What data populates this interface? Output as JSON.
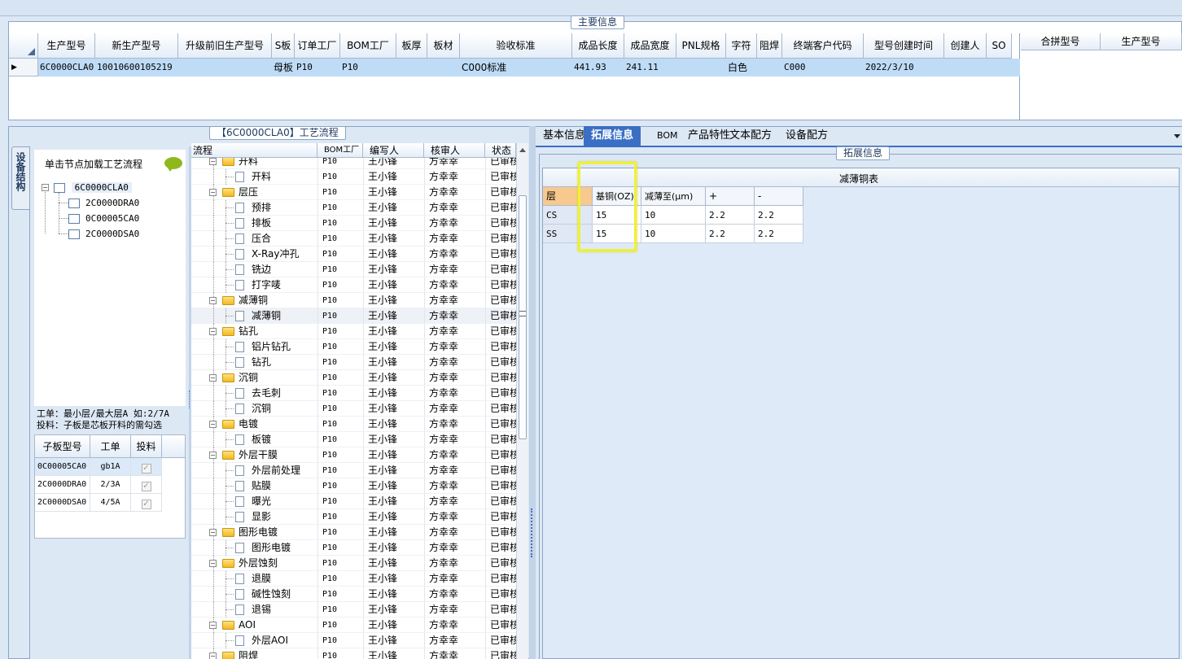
{
  "main_info": {
    "title": "主要信息",
    "columns": [
      "生产型号",
      "新生产型号",
      "升级前旧生产型号",
      "S板",
      "订单工厂",
      "BOM工厂",
      "板厚",
      "板材",
      "验收标准",
      "成品长度",
      "成品宽度",
      "PNL规格",
      "字符",
      "阻焊",
      "终端客户代码",
      "型号创建时间",
      "创建人",
      "SO"
    ],
    "row": [
      "6C0000CLA0",
      "10010600105219",
      "",
      "母板",
      "P10",
      "P10",
      "",
      "",
      "C000标准",
      "441.93",
      "241.11",
      "",
      "白色",
      "",
      "C000",
      "2022/3/10",
      "",
      ""
    ],
    "row_marker": "▶"
  },
  "merge_panel": {
    "columns": [
      "合拼型号",
      "生产型号"
    ]
  },
  "process_panel": {
    "title": "【6C0000CLA0】工艺流程"
  },
  "side_tab": {
    "label": "设备结构"
  },
  "structure": {
    "hint": "单击节点加载工艺流程",
    "tree": {
      "root": "6C0000CLA0",
      "children": [
        "2C0000DRA0",
        "0C00005CA0",
        "2C0000DSA0"
      ]
    },
    "note_line1": "工单：最小层/最大层A 如:2/7A",
    "note_line2": "投料：子板是芯板开料的需勾选",
    "sub_columns": [
      "子板型号",
      "工单",
      "投料"
    ],
    "sub_rows": [
      {
        "model": "0C00005CA0",
        "order": "gb1A",
        "check": "✓"
      },
      {
        "model": "2C0000DRA0",
        "order": "2/3A",
        "check": "✓"
      },
      {
        "model": "2C0000DSA0",
        "order": "4/5A",
        "check": "✓"
      }
    ]
  },
  "flow": {
    "columns": [
      "流程",
      "BOM工厂",
      "编写人",
      "核审人",
      "状态"
    ],
    "rows": [
      {
        "name": "开料",
        "level": 1,
        "factory": "P10",
        "writer": "王小锋",
        "reviewer": "方幸幸",
        "status": "已审核"
      },
      {
        "name": "开料",
        "level": 2,
        "factory": "P10",
        "writer": "王小锋",
        "reviewer": "方幸幸",
        "status": "已审核"
      },
      {
        "name": "层压",
        "level": 1,
        "factory": "P10",
        "writer": "王小锋",
        "reviewer": "方幸幸",
        "status": "已审核"
      },
      {
        "name": "预排",
        "level": 2,
        "factory": "P10",
        "writer": "王小锋",
        "reviewer": "方幸幸",
        "status": "已审核"
      },
      {
        "name": "排板",
        "level": 2,
        "factory": "P10",
        "writer": "王小锋",
        "reviewer": "方幸幸",
        "status": "已审核"
      },
      {
        "name": "压合",
        "level": 2,
        "factory": "P10",
        "writer": "王小锋",
        "reviewer": "方幸幸",
        "status": "已审核"
      },
      {
        "name": "X-Ray冲孔",
        "level": 2,
        "factory": "P10",
        "writer": "王小锋",
        "reviewer": "方幸幸",
        "status": "已审核"
      },
      {
        "name": "铣边",
        "level": 2,
        "factory": "P10",
        "writer": "王小锋",
        "reviewer": "方幸幸",
        "status": "已审核"
      },
      {
        "name": "打字唛",
        "level": 2,
        "factory": "P10",
        "writer": "王小锋",
        "reviewer": "方幸幸",
        "status": "已审核"
      },
      {
        "name": "减薄铜",
        "level": 1,
        "factory": "P10",
        "writer": "王小锋",
        "reviewer": "方幸幸",
        "status": "已审核"
      },
      {
        "name": "减薄铜",
        "level": 2,
        "factory": "P10",
        "writer": "王小锋",
        "reviewer": "方幸幸",
        "status": "已审核"
      },
      {
        "name": "钻孔",
        "level": 1,
        "factory": "P10",
        "writer": "王小锋",
        "reviewer": "方幸幸",
        "status": "已审核"
      },
      {
        "name": "铝片钻孔",
        "level": 2,
        "factory": "P10",
        "writer": "王小锋",
        "reviewer": "方幸幸",
        "status": "已审核"
      },
      {
        "name": "钻孔",
        "level": 2,
        "factory": "P10",
        "writer": "王小锋",
        "reviewer": "方幸幸",
        "status": "已审核"
      },
      {
        "name": "沉铜",
        "level": 1,
        "factory": "P10",
        "writer": "王小锋",
        "reviewer": "方幸幸",
        "status": "已审核"
      },
      {
        "name": "去毛刺",
        "level": 2,
        "factory": "P10",
        "writer": "王小锋",
        "reviewer": "方幸幸",
        "status": "已审核"
      },
      {
        "name": "沉铜",
        "level": 2,
        "factory": "P10",
        "writer": "王小锋",
        "reviewer": "方幸幸",
        "status": "已审核"
      },
      {
        "name": "电镀",
        "level": 1,
        "factory": "P10",
        "writer": "王小锋",
        "reviewer": "方幸幸",
        "status": "已审核"
      },
      {
        "name": "板镀",
        "level": 2,
        "factory": "P10",
        "writer": "王小锋",
        "reviewer": "方幸幸",
        "status": "已审核"
      },
      {
        "name": "外层干膜",
        "level": 1,
        "factory": "P10",
        "writer": "王小锋",
        "reviewer": "方幸幸",
        "status": "已审核"
      },
      {
        "name": "外层前处理",
        "level": 2,
        "factory": "P10",
        "writer": "王小锋",
        "reviewer": "方幸幸",
        "status": "已审核"
      },
      {
        "name": "贴膜",
        "level": 2,
        "factory": "P10",
        "writer": "王小锋",
        "reviewer": "方幸幸",
        "status": "已审核"
      },
      {
        "name": "曝光",
        "level": 2,
        "factory": "P10",
        "writer": "王小锋",
        "reviewer": "方幸幸",
        "status": "已审核"
      },
      {
        "name": "显影",
        "level": 2,
        "factory": "P10",
        "writer": "王小锋",
        "reviewer": "方幸幸",
        "status": "已审核"
      },
      {
        "name": "图形电镀",
        "level": 1,
        "factory": "P10",
        "writer": "王小锋",
        "reviewer": "方幸幸",
        "status": "已审核"
      },
      {
        "name": "图形电镀",
        "level": 2,
        "factory": "P10",
        "writer": "王小锋",
        "reviewer": "方幸幸",
        "status": "已审核"
      },
      {
        "name": "外层蚀刻",
        "level": 1,
        "factory": "P10",
        "writer": "王小锋",
        "reviewer": "方幸幸",
        "status": "已审核"
      },
      {
        "name": "退膜",
        "level": 2,
        "factory": "P10",
        "writer": "王小锋",
        "reviewer": "方幸幸",
        "status": "已审核"
      },
      {
        "name": "碱性蚀刻",
        "level": 2,
        "factory": "P10",
        "writer": "王小锋",
        "reviewer": "方幸幸",
        "status": "已审核"
      },
      {
        "name": "退锡",
        "level": 2,
        "factory": "P10",
        "writer": "王小锋",
        "reviewer": "方幸幸",
        "status": "已审核"
      },
      {
        "name": "AOI",
        "level": 1,
        "factory": "P10",
        "writer": "王小锋",
        "reviewer": "方幸幸",
        "status": "已审核"
      },
      {
        "name": "外层AOI",
        "level": 2,
        "factory": "P10",
        "writer": "王小锋",
        "reviewer": "方幸幸",
        "status": "已审核"
      },
      {
        "name": "阻焊",
        "level": 1,
        "factory": "P10",
        "writer": "王小锋",
        "reviewer": "方幸幸",
        "status": "已审核"
      }
    ],
    "selected_index": 10
  },
  "detail_tabs": {
    "tabs": [
      "基本信息",
      "拓展信息",
      "BOM",
      "产品特性",
      "文本配方",
      "设备配方"
    ],
    "active_index": 1,
    "group_title": "拓展信息",
    "table_title": "减薄铜表",
    "columns": [
      "层",
      "基铜(OZ)",
      "减薄至(μm)",
      "+",
      "-"
    ],
    "rows": [
      [
        "CS",
        "15",
        "10",
        "2.2",
        "2.2"
      ],
      [
        "SS",
        "15",
        "10",
        "2.2",
        "2.2"
      ]
    ]
  },
  "colors": {
    "accent": "#3a6fc4",
    "selection": "#bfdcf7",
    "highlight_box": "#f0f03a",
    "panel_bg": "#dde8f5"
  }
}
